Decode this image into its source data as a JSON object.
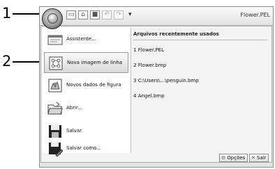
{
  "callouts": [
    {
      "number": "1"
    },
    {
      "number": "2"
    }
  ],
  "window": {
    "title": "Flower.PEL"
  },
  "quick_access": [
    "new-icon",
    "open-icon",
    "save-icon",
    "undo-icon",
    "redo-icon",
    "customize-dropdown-icon"
  ],
  "menu": {
    "items": [
      {
        "label": "Assistente...",
        "icon": "wizard-icon",
        "selected": false
      },
      {
        "label": "Nova imagem de linha",
        "icon": "new-line-image-icon",
        "selected": true
      },
      {
        "label": "Novos dados de figura",
        "icon": "new-figure-data-icon",
        "selected": false
      },
      {
        "label": "Abrir...",
        "icon": "folder-open-icon",
        "selected": false
      },
      {
        "label": "Salvar",
        "icon": "floppy-disk-icon",
        "selected": false
      },
      {
        "label": "Salvar como...",
        "icon": "floppy-disk-save-as-icon",
        "selected": false
      }
    ]
  },
  "recent": {
    "header": "Arquivos recentemente usados",
    "items": [
      {
        "label": "Flower.PEL",
        "prefix": "1"
      },
      {
        "label": "Flower.bmp",
        "prefix": "2"
      },
      {
        "label": "C:\\Users\\...\\penguin.bmp",
        "prefix": "3"
      },
      {
        "label": "Angel.bmp",
        "prefix": "4"
      }
    ]
  },
  "footer": {
    "options_label": "Opções",
    "exit_label": "Sair"
  }
}
